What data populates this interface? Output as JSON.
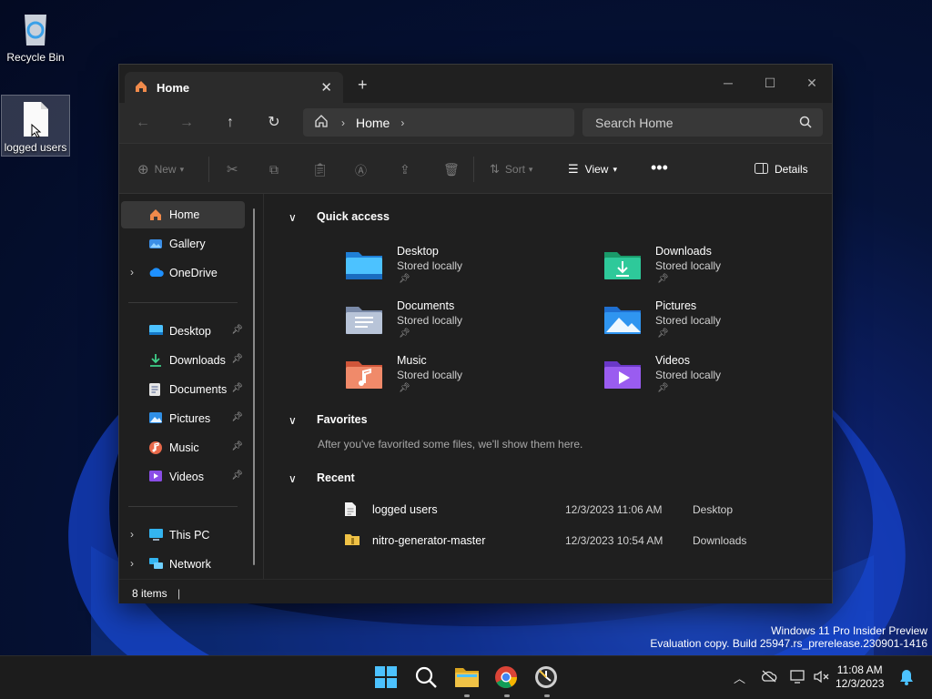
{
  "desktop": {
    "icons": [
      {
        "label": "Recycle Bin"
      },
      {
        "label": "logged users"
      }
    ]
  },
  "explorer": {
    "tab": {
      "label": "Home"
    },
    "address": {
      "crumb": "Home"
    },
    "search": {
      "placeholder": "Search Home"
    },
    "toolbar": {
      "new_label": "New",
      "sort_label": "Sort",
      "view_label": "View",
      "details_label": "Details"
    },
    "sidebar": {
      "top": [
        {
          "label": "Home"
        },
        {
          "label": "Gallery"
        },
        {
          "label": "OneDrive"
        }
      ],
      "pinned": [
        {
          "label": "Desktop"
        },
        {
          "label": "Downloads"
        },
        {
          "label": "Documents"
        },
        {
          "label": "Pictures"
        },
        {
          "label": "Music"
        },
        {
          "label": "Videos"
        }
      ],
      "bottom": [
        {
          "label": "This PC"
        },
        {
          "label": "Network"
        }
      ]
    },
    "sections": {
      "quick_access": "Quick access",
      "favorites": "Favorites",
      "recent": "Recent"
    },
    "quick_access": [
      {
        "name": "Desktop",
        "sub": "Stored locally"
      },
      {
        "name": "Downloads",
        "sub": "Stored locally"
      },
      {
        "name": "Documents",
        "sub": "Stored locally"
      },
      {
        "name": "Pictures",
        "sub": "Stored locally"
      },
      {
        "name": "Music",
        "sub": "Stored locally"
      },
      {
        "name": "Videos",
        "sub": "Stored locally"
      }
    ],
    "favorites_message": "After you've favorited some files, we'll show them here.",
    "recent": [
      {
        "name": "logged users",
        "date": "12/3/2023 11:06 AM",
        "location": "Desktop"
      },
      {
        "name": "nitro-generator-master",
        "date": "12/3/2023 10:54 AM",
        "location": "Downloads"
      }
    ],
    "status": "8 items"
  },
  "watermark": {
    "line1": "Windows 11 Pro Insider Preview",
    "line2": "Evaluation copy. Build 25947.rs_prerelease.230901-1416"
  },
  "clock": {
    "time": "11:08 AM",
    "date": "12/3/2023"
  },
  "colors": {
    "accent": "#4cc2ff",
    "folder_yellow": "#f0c246",
    "window_bg": "#1f1f1f"
  }
}
